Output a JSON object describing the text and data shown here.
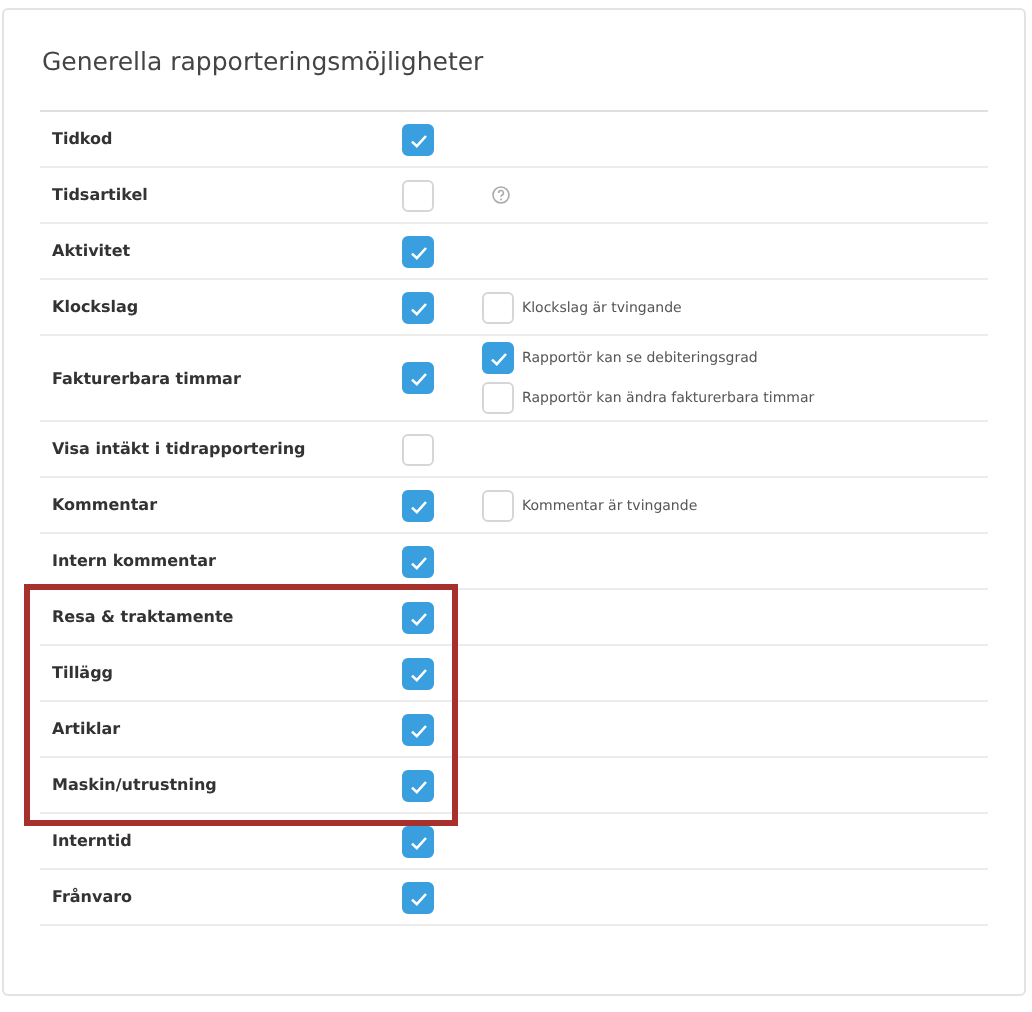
{
  "title": "Generella rapporteringsmöjligheter",
  "rows": [
    {
      "label": "Tidkod",
      "checked": true,
      "highlighted": false
    },
    {
      "label": "Tidsartikel",
      "checked": false,
      "highlighted": false,
      "extras": [
        {
          "kind": "help"
        }
      ]
    },
    {
      "label": "Aktivitet",
      "checked": true,
      "highlighted": false
    },
    {
      "label": "Klockslag",
      "checked": true,
      "highlighted": false,
      "extras": [
        {
          "kind": "checkbox",
          "label": "Klockslag är tvingande",
          "checked": false
        }
      ]
    },
    {
      "label": "Fakturerbara timmar",
      "checked": true,
      "highlighted": false,
      "extras": [
        {
          "kind": "checkbox",
          "label": "Rapportör kan se debiteringsgrad",
          "checked": true
        },
        {
          "kind": "checkbox",
          "label": "Rapportör kan ändra fakturerbara timmar",
          "checked": false
        }
      ]
    },
    {
      "label": "Visa intäkt i tidrapportering",
      "checked": false,
      "highlighted": false
    },
    {
      "label": "Kommentar",
      "checked": true,
      "highlighted": false,
      "extras": [
        {
          "kind": "checkbox",
          "label": "Kommentar är tvingande",
          "checked": false
        }
      ]
    },
    {
      "label": "Intern kommentar",
      "checked": true,
      "highlighted": false
    },
    {
      "label": "Resa & traktamente",
      "checked": true,
      "highlighted": true
    },
    {
      "label": "Tillägg",
      "checked": true,
      "highlighted": true
    },
    {
      "label": "Artiklar",
      "checked": true,
      "highlighted": true
    },
    {
      "label": "Maskin/utrustning",
      "checked": true,
      "highlighted": true
    },
    {
      "label": "Interntid",
      "checked": true,
      "highlighted": false
    },
    {
      "label": "Frånvaro",
      "checked": true,
      "highlighted": false
    }
  ]
}
